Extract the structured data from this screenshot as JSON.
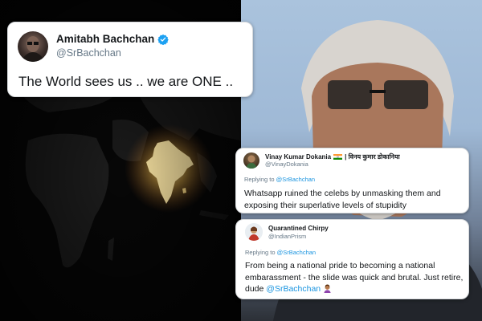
{
  "main_tweet": {
    "name": "Amitabh Bachchan",
    "handle": "@SrBachchan",
    "text": "The World sees us .. we are ONE .."
  },
  "replies": [
    {
      "name": "Vinay Kumar Dokania",
      "name_hindi": "| विनय कुमार डोकानिया",
      "handle": "@VinayDokania",
      "replying_prefix": "Replying to",
      "replying_to": "@SrBachchan",
      "body": "Whatsapp ruined the celebs by unmasking them and exposing their superlative levels of stupidity",
      "badge_icon": "india-flag-icon"
    },
    {
      "name": "Quarantined Chirpy",
      "handle": "@IndianPrism",
      "replying_prefix": "Replying to",
      "replying_to": "@SrBachchan",
      "body": "From being a national pride to becoming a national embarassment - the slide was quick and brutal. Just retire, dude",
      "body_mention": "@SrBachchan",
      "end_icon": "facepalm-emoji-icon"
    }
  ],
  "colors": {
    "text_primary": "#14171a",
    "text_secondary": "#657786",
    "mention": "#1b95e0",
    "verified": "#1da1f2",
    "map_glow": "#ffdf7a"
  }
}
